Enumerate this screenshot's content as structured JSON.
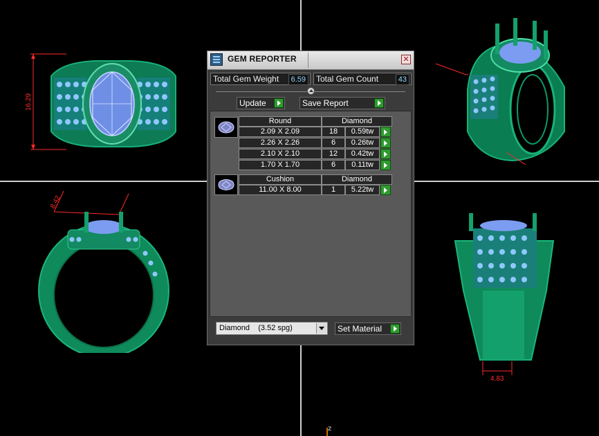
{
  "viewport": {
    "axis_label": "z",
    "dimensions": {
      "top_left": "16.29",
      "bottom_left": "8.42",
      "bottom_right": "4.83"
    }
  },
  "gem_reporter": {
    "title": "GEM REPORTER",
    "close_symbol": "✕",
    "total_weight_label": "Total Gem Weight",
    "total_weight_value": "6.59",
    "total_count_label": "Total Gem Count",
    "total_count_value": "43",
    "update_label": "Update",
    "save_report_label": "Save Report",
    "groups": [
      {
        "shape": "Round",
        "material": "Diamond",
        "rows": [
          {
            "size": "2.09 X 2.09",
            "count": "18",
            "weight": "0.59tw"
          },
          {
            "size": "2.26 X 2.26",
            "count": "6",
            "weight": "0.26tw"
          },
          {
            "size": "2.10 X 2.10",
            "count": "12",
            "weight": "0.42tw"
          },
          {
            "size": "1.70 X 1.70",
            "count": "6",
            "weight": "0.11tw"
          }
        ]
      },
      {
        "shape": "Cushion",
        "material": "Diamond",
        "rows": [
          {
            "size": "11.00 X 8.00",
            "count": "1",
            "weight": "5.22tw"
          }
        ]
      }
    ],
    "material_select": "Diamond    (3.52 spg)",
    "set_material_label": "Set Material"
  }
}
